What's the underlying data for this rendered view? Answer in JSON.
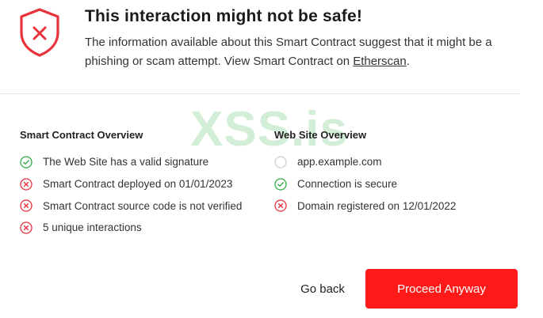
{
  "header": {
    "title": "This interaction might not be safe!",
    "description": "The information available about this Smart Contract suggest that it might be a phishing or scam attempt. View Smart Contract on ",
    "link_text": "Etherscan",
    "description_end": "."
  },
  "watermark": "XSS.is",
  "smart_contract": {
    "title": "Smart Contract Overview",
    "items": [
      {
        "label": "The Web Site has a valid signature",
        "status": "ok"
      },
      {
        "label": "Smart Contract deployed on 01/01/2023",
        "status": "error"
      },
      {
        "label": "Smart Contract source code is not verified",
        "status": "error"
      },
      {
        "label": "5 unique interactions",
        "status": "error"
      }
    ]
  },
  "web_site": {
    "title": "Web Site Overview",
    "items": [
      {
        "label": "app.example.com",
        "status": "neutral"
      },
      {
        "label": "Connection is secure",
        "status": "ok"
      },
      {
        "label": "Domain registered on 12/01/2022",
        "status": "error"
      }
    ]
  },
  "actions": {
    "go_back": "Go back",
    "proceed": "Proceed Anyway"
  },
  "colors": {
    "danger": "#ff1a1a",
    "success": "#2fae4a",
    "neutral": "#cfcfcf"
  }
}
